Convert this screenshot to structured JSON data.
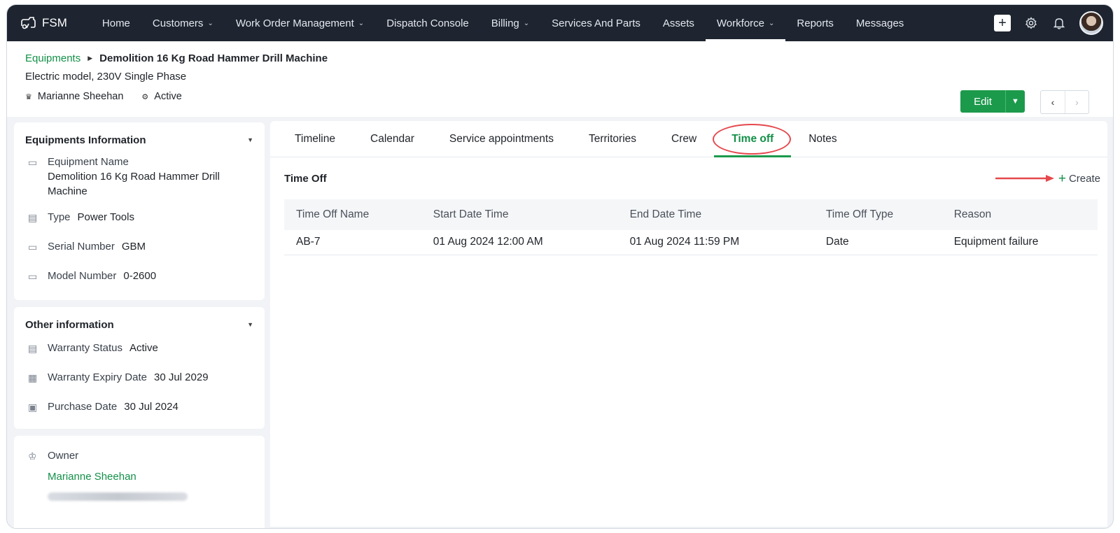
{
  "nav": {
    "app_name": "FSM",
    "items": [
      {
        "label": "Home",
        "dropdown": false
      },
      {
        "label": "Customers",
        "dropdown": true
      },
      {
        "label": "Work Order Management",
        "dropdown": true
      },
      {
        "label": "Dispatch Console",
        "dropdown": false
      },
      {
        "label": "Billing",
        "dropdown": true
      },
      {
        "label": "Services And Parts",
        "dropdown": false
      },
      {
        "label": "Assets",
        "dropdown": false
      },
      {
        "label": "Workforce",
        "dropdown": true,
        "active": true
      },
      {
        "label": "Reports",
        "dropdown": false
      },
      {
        "label": "Messages",
        "dropdown": false
      }
    ],
    "icons": [
      "add-icon",
      "gear-icon",
      "bell-icon",
      "avatar"
    ]
  },
  "header": {
    "breadcrumb_link": "Equipments",
    "title": "Demolition 16 Kg Road Hammer Drill Machine",
    "subtitle": "Electric model, 230V Single Phase",
    "owner": "Marianne Sheehan",
    "status": "Active",
    "edit_label": "Edit"
  },
  "equipment_info": {
    "heading": "Equipments Information",
    "name_label": "Equipment Name",
    "name_value": "Demolition 16 Kg Road Hammer Drill Machine",
    "type_label": "Type",
    "type_value": "Power Tools",
    "serial_label": "Serial Number",
    "serial_value": "GBM",
    "model_label": "Model Number",
    "model_value": "0-2600"
  },
  "other_info": {
    "heading": "Other information",
    "warranty_status_label": "Warranty Status",
    "warranty_status_value": "Active",
    "warranty_expiry_label": "Warranty Expiry Date",
    "warranty_expiry_value": "30 Jul 2029",
    "purchase_label": "Purchase Date",
    "purchase_value": "30 Jul 2024"
  },
  "owner_card": {
    "label": "Owner",
    "name": "Marianne Sheehan"
  },
  "tabs": [
    "Timeline",
    "Calendar",
    "Service appointments",
    "Territories",
    "Crew",
    "Time off",
    "Notes"
  ],
  "active_tab": "Time off",
  "time_off": {
    "title": "Time Off",
    "create_label": "Create",
    "columns": [
      "Time Off Name",
      "Start Date Time",
      "End Date Time",
      "Time Off Type",
      "Reason"
    ],
    "rows": [
      [
        "AB-7",
        "01 Aug 2024 12:00 AM",
        "01 Aug 2024 11:59 PM",
        "Date",
        "Equipment failure"
      ]
    ]
  },
  "colors": {
    "nav_bg": "#1e2530",
    "accent_green": "#1c9a4c",
    "annotation_red": "#e5484d"
  }
}
